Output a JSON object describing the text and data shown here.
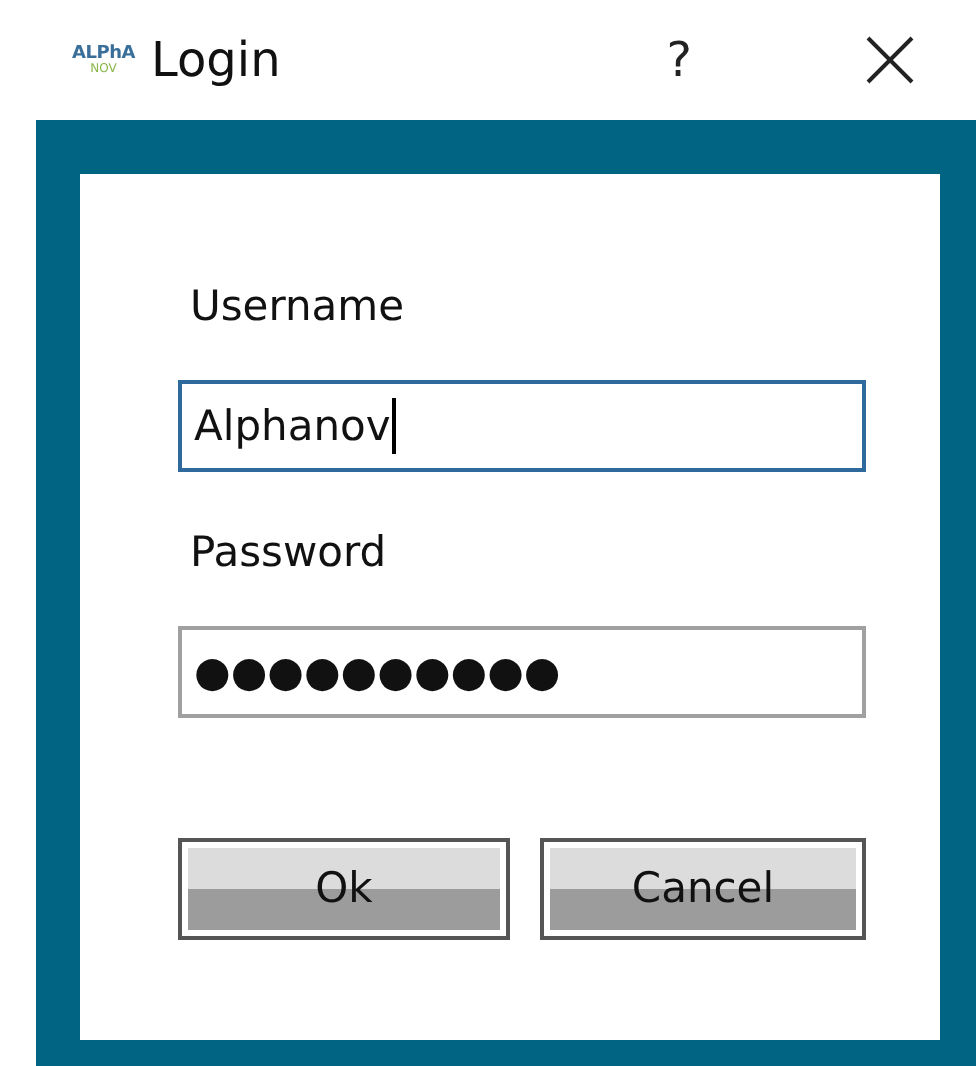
{
  "window": {
    "logo": {
      "top": "ALPhA",
      "bottom": "NOV"
    },
    "title": "Login",
    "help": "?"
  },
  "form": {
    "username_label": "Username",
    "username": {
      "value": "Alphanov",
      "focused": true
    },
    "password_label": "Password",
    "password": {
      "value": "●●●●●●●●●●",
      "focused": false
    }
  },
  "buttons": [
    "Ok",
    "Cancel"
  ]
}
